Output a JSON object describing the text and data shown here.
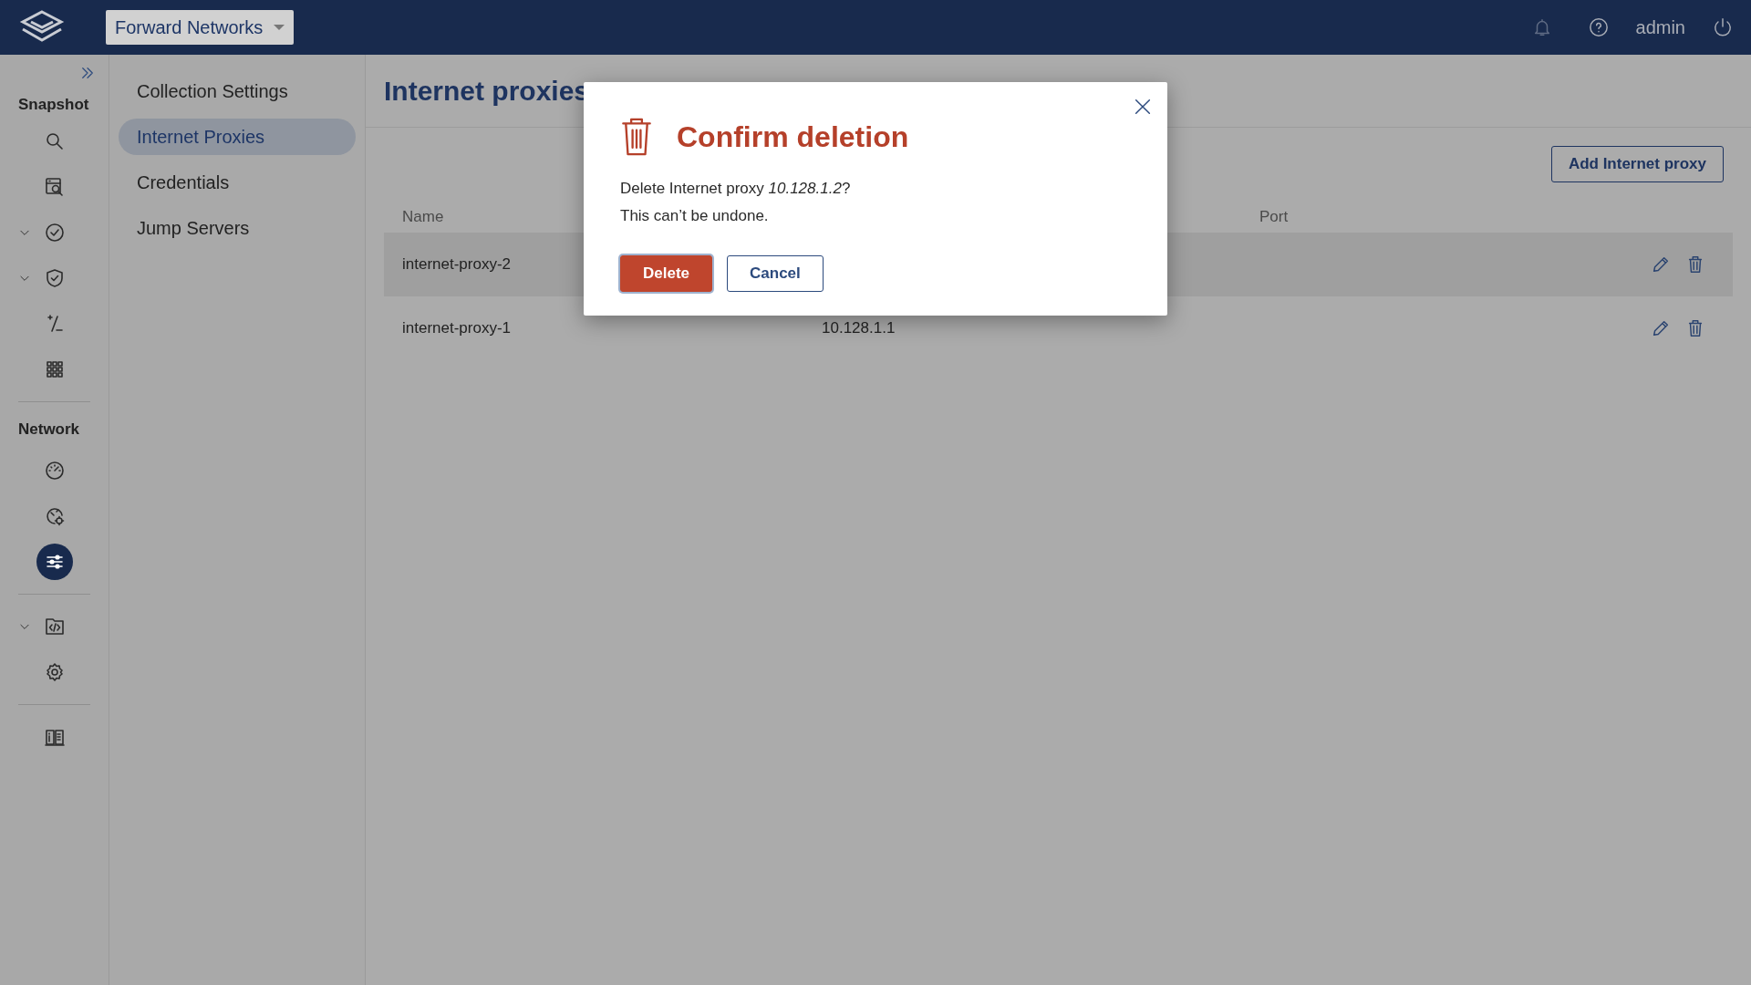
{
  "header": {
    "org_selector": "Forward Networks",
    "user": "admin"
  },
  "rail": {
    "sections": [
      {
        "label": "Snapshot",
        "items": [
          {
            "kind": "search",
            "expandable": false,
            "selected": false
          },
          {
            "kind": "server-search",
            "expandable": false,
            "selected": false
          },
          {
            "kind": "check-circle",
            "expandable": true,
            "selected": false
          },
          {
            "kind": "shield-check",
            "expandable": true,
            "selected": false
          },
          {
            "kind": "plus-minus",
            "expandable": false,
            "selected": false
          },
          {
            "kind": "grid",
            "expandable": false,
            "selected": false
          }
        ]
      },
      {
        "label": "Network",
        "items": [
          {
            "kind": "gauge",
            "expandable": false,
            "selected": false
          },
          {
            "kind": "globe-gear",
            "expandable": false,
            "selected": false
          },
          {
            "kind": "sliders",
            "expandable": false,
            "selected": true
          }
        ]
      },
      {
        "items": [
          {
            "kind": "code-file",
            "expandable": true,
            "selected": false
          },
          {
            "kind": "gear",
            "expandable": false,
            "selected": false
          }
        ]
      },
      {
        "items": [
          {
            "kind": "book",
            "expandable": false,
            "selected": false
          }
        ]
      }
    ]
  },
  "submenu": [
    {
      "label": "Collection Settings",
      "selected": false
    },
    {
      "label": "Internet Proxies",
      "selected": true
    },
    {
      "label": "Credentials",
      "selected": false
    },
    {
      "label": "Jump Servers",
      "selected": false
    }
  ],
  "page": {
    "title": "Internet proxies",
    "add_button": "Add Internet proxy",
    "table": {
      "columns": {
        "name": "Name",
        "port": "Port"
      },
      "rows": [
        {
          "name": "internet-proxy-2",
          "highlighted": true
        },
        {
          "name": "internet-proxy-1",
          "column_2": "10.128.1.1",
          "highlighted": false
        }
      ]
    }
  },
  "dialog": {
    "title": "Confirm deletion",
    "message": "Delete Internet proxy *10.128.1.2*?",
    "note": "This can’t be undone.",
    "buttons": [
      {
        "label": "Delete",
        "kind": "danger"
      },
      {
        "label": "Cancel",
        "kind": "secondary"
      }
    ]
  }
}
